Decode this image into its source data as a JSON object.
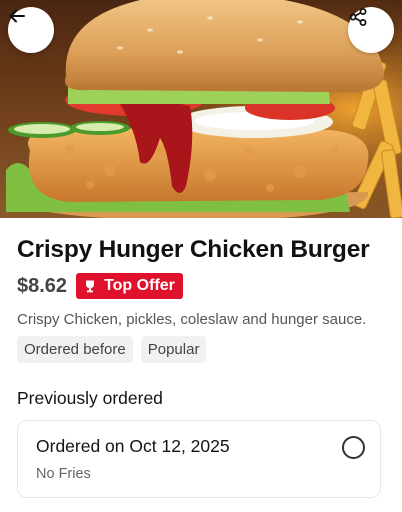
{
  "product": {
    "name": "Crispy Hunger Chicken Burger",
    "price": "$8.62",
    "badge": "Top Offer",
    "description": "Crispy Chicken, pickles, coleslaw and hunger sauce.",
    "tags": [
      "Ordered before",
      "Popular"
    ]
  },
  "previous_orders": {
    "title": "Previously ordered",
    "orders": [
      {
        "date": "Ordered on Oct 12, 2025",
        "note": "No Fries",
        "selected": false
      }
    ]
  },
  "icons": {
    "back": "arrow-left-icon",
    "share": "share-icon",
    "badge": "trophy-icon",
    "order_select": "radio-icon"
  },
  "colors": {
    "badge_bg": "#e0112c",
    "tag_bg": "#f1f1f1",
    "title": "#111111",
    "price": "#444444"
  }
}
